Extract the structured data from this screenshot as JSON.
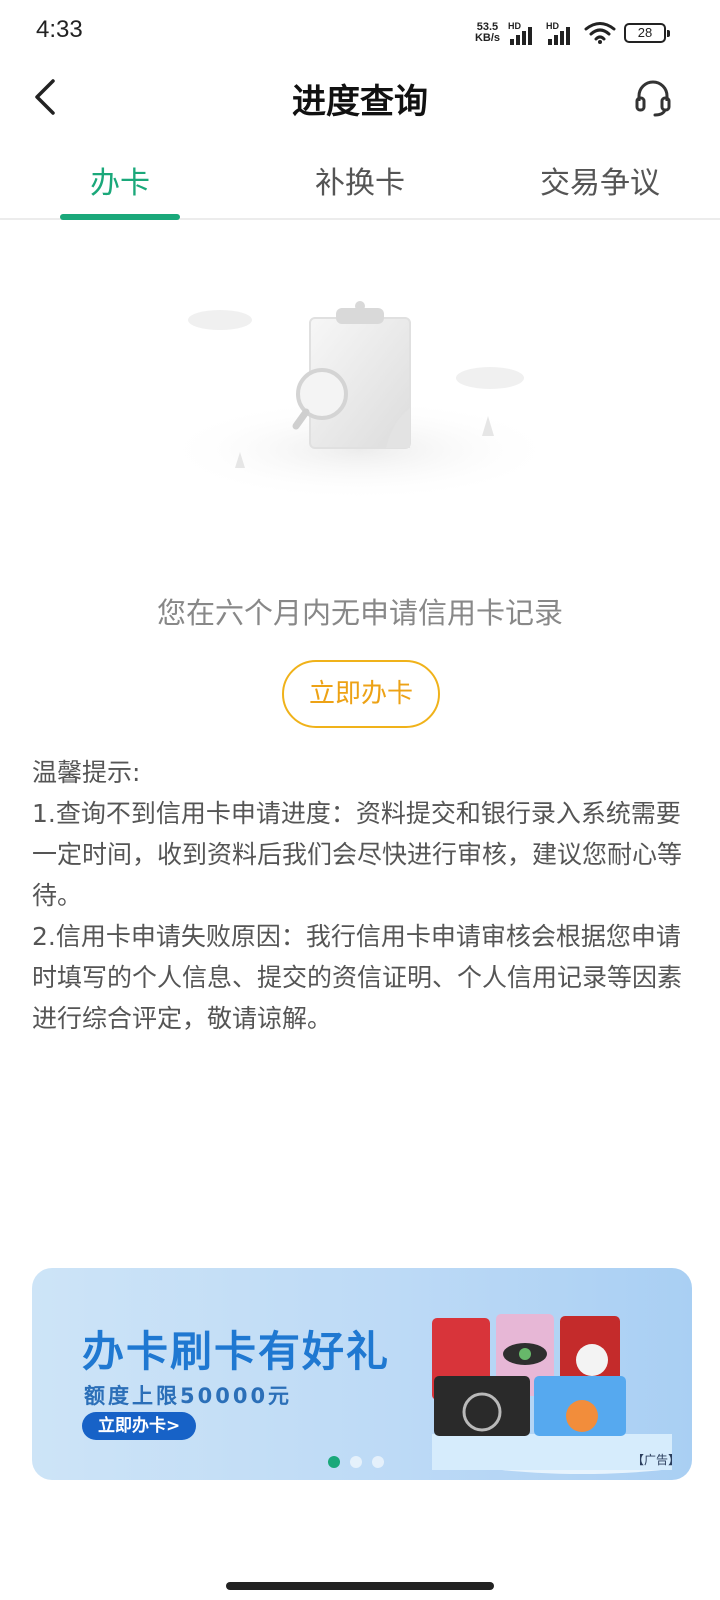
{
  "status_bar": {
    "time": "4:33",
    "net_speed_value": "53.5",
    "net_speed_unit": "KB/s",
    "signal1_label": "HD",
    "signal2_label": "HD",
    "battery": "28"
  },
  "header": {
    "title": "进度查询",
    "back_icon": "back-arrow",
    "support_icon": "headset"
  },
  "tabs": [
    {
      "label": "办卡",
      "active": true
    },
    {
      "label": "补换卡",
      "active": false
    },
    {
      "label": "交易争议",
      "active": false
    }
  ],
  "empty_state": {
    "message": "您在六个月内无申请信用卡记录",
    "button": "立即办卡"
  },
  "tips": {
    "heading": "温馨提示:",
    "item1": "1.查询不到信用卡申请进度：资料提交和银行录入系统需要一定时间，收到资料后我们会尽快进行审核，建议您耐心等待。",
    "item2": "2.信用卡申请失败原因：我行信用卡申请审核会根据您申请时填写的个人信息、提交的资信证明、个人信用记录等因素进行综合评定，敬请谅解。"
  },
  "banner": {
    "title": "办卡刷卡有好礼",
    "subtitle": "额度上限50000元",
    "button": "立即办卡>",
    "ad_label": "【广告】",
    "dots_count": 3,
    "active_dot": 0
  },
  "colors": {
    "accent": "#1aa87a",
    "button_orange": "#eda215",
    "banner_blue": "#1f78d1"
  }
}
